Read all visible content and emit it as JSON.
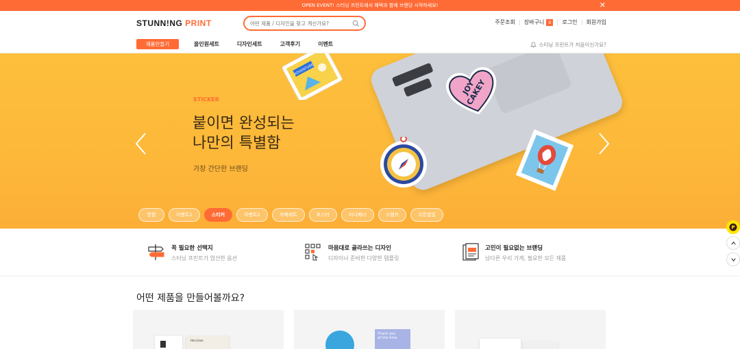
{
  "topbar": {
    "text": "OPEN EVENT! 스터닝 프린트에서 혜택과 함께 브랜딩 시작하세요!"
  },
  "header": {
    "logo_part1": "STUNN!NG",
    "logo_part2": "PRINT",
    "search_placeholder": "어떤 제품 / 디자인을 찾고 계신가요?",
    "util": {
      "order": "주문조회",
      "cart": "장바구니",
      "cart_count": "0",
      "login": "로그인",
      "signup": "회원가입"
    }
  },
  "nav": {
    "make_button": "제품만들기",
    "items": [
      "올인원세트",
      "디자인세트",
      "고객후기",
      "이벤트"
    ],
    "help": "스터닝 프린트가 처음이신가요?"
  },
  "banner": {
    "eyebrow": "STICKER",
    "headline_line1": "붙이면 완성되는",
    "headline_line2": "나만의 특별함",
    "sub": "가장 간단한 브랜딩",
    "sticker_text1": "JOY",
    "sticker_text2": "CAKEY",
    "postcard_text": "ADVENTURE",
    "pills": [
      "명함",
      "이벤트1",
      "스티커",
      "이벤트2",
      "카페세트",
      "포스터",
      "미니배너",
      "스탬프",
      "오픈할임"
    ],
    "active_pill": 2
  },
  "features": [
    {
      "title": "꼭 필요한 선택지",
      "desc": "스터닝 프린트가 엄선한 옵션",
      "icon": "signpost-icon"
    },
    {
      "title": "마음대로 골라쓰는 디자인",
      "desc": "디자이너 준비한 다양한 템플릿",
      "icon": "design-grid-icon"
    },
    {
      "title": "고민이 필요없는 브랜딩",
      "desc": "남다른 우리 가게, 필요한 모든 제품",
      "icon": "branding-doc-icon"
    }
  ],
  "section": {
    "title": "어떤 제품을 만들어볼까요?"
  },
  "cards": {
    "card1_text": "Han Jisoo",
    "card2_text1": "Thank you",
    "card2_text2": "all the time"
  },
  "colors": {
    "accent": "#ff6b35",
    "banner": "#fdbf3c",
    "kakao": "#fee500"
  }
}
